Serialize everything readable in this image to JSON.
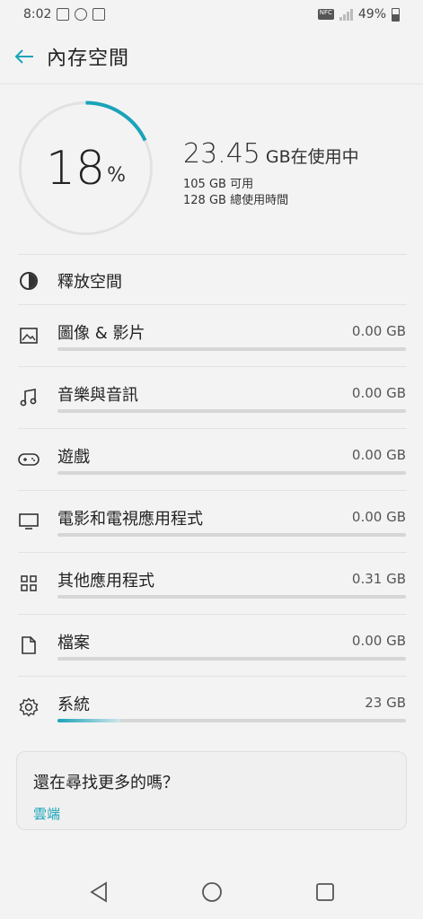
{
  "status_bar": {
    "time": "8:02",
    "battery": "49%",
    "nfc": "NFC"
  },
  "header": {
    "title": "內存空間"
  },
  "summary": {
    "percent": "18",
    "percent_unit": "%",
    "percent_value": 18,
    "used_amount": "23.45",
    "used_label": "GB在使用中",
    "available": "105 GB 可用",
    "total": "128 GB 總使用時間"
  },
  "free_space": {
    "label": "釋放空間"
  },
  "categories": [
    {
      "label": "圖像 & 影片",
      "size": "0.00 GB",
      "icon": "image-icon",
      "fill": 0
    },
    {
      "label": "音樂與音訊",
      "size": "0.00 GB",
      "icon": "music-icon",
      "fill": 0
    },
    {
      "label": "遊戲",
      "size": "0.00 GB",
      "icon": "gamepad-icon",
      "fill": 0
    },
    {
      "label": "電影和電視應用程式",
      "size": "0.00 GB",
      "icon": "tv-icon",
      "fill": 0
    },
    {
      "label": "其他應用程式",
      "size": "0.31 GB",
      "icon": "apps-grid-icon",
      "fill": 0
    },
    {
      "label": "檔案",
      "size": "0.00 GB",
      "icon": "file-icon",
      "fill": 0
    },
    {
      "label": "系統",
      "size": "23 GB",
      "icon": "gear-icon",
      "fill": 0.18
    }
  ],
  "card": {
    "title": "還在尋找更多的嗎？",
    "link": "雲端"
  },
  "colors": {
    "accent": "#1aa3b9",
    "ring_track": "#e2e2e2"
  }
}
